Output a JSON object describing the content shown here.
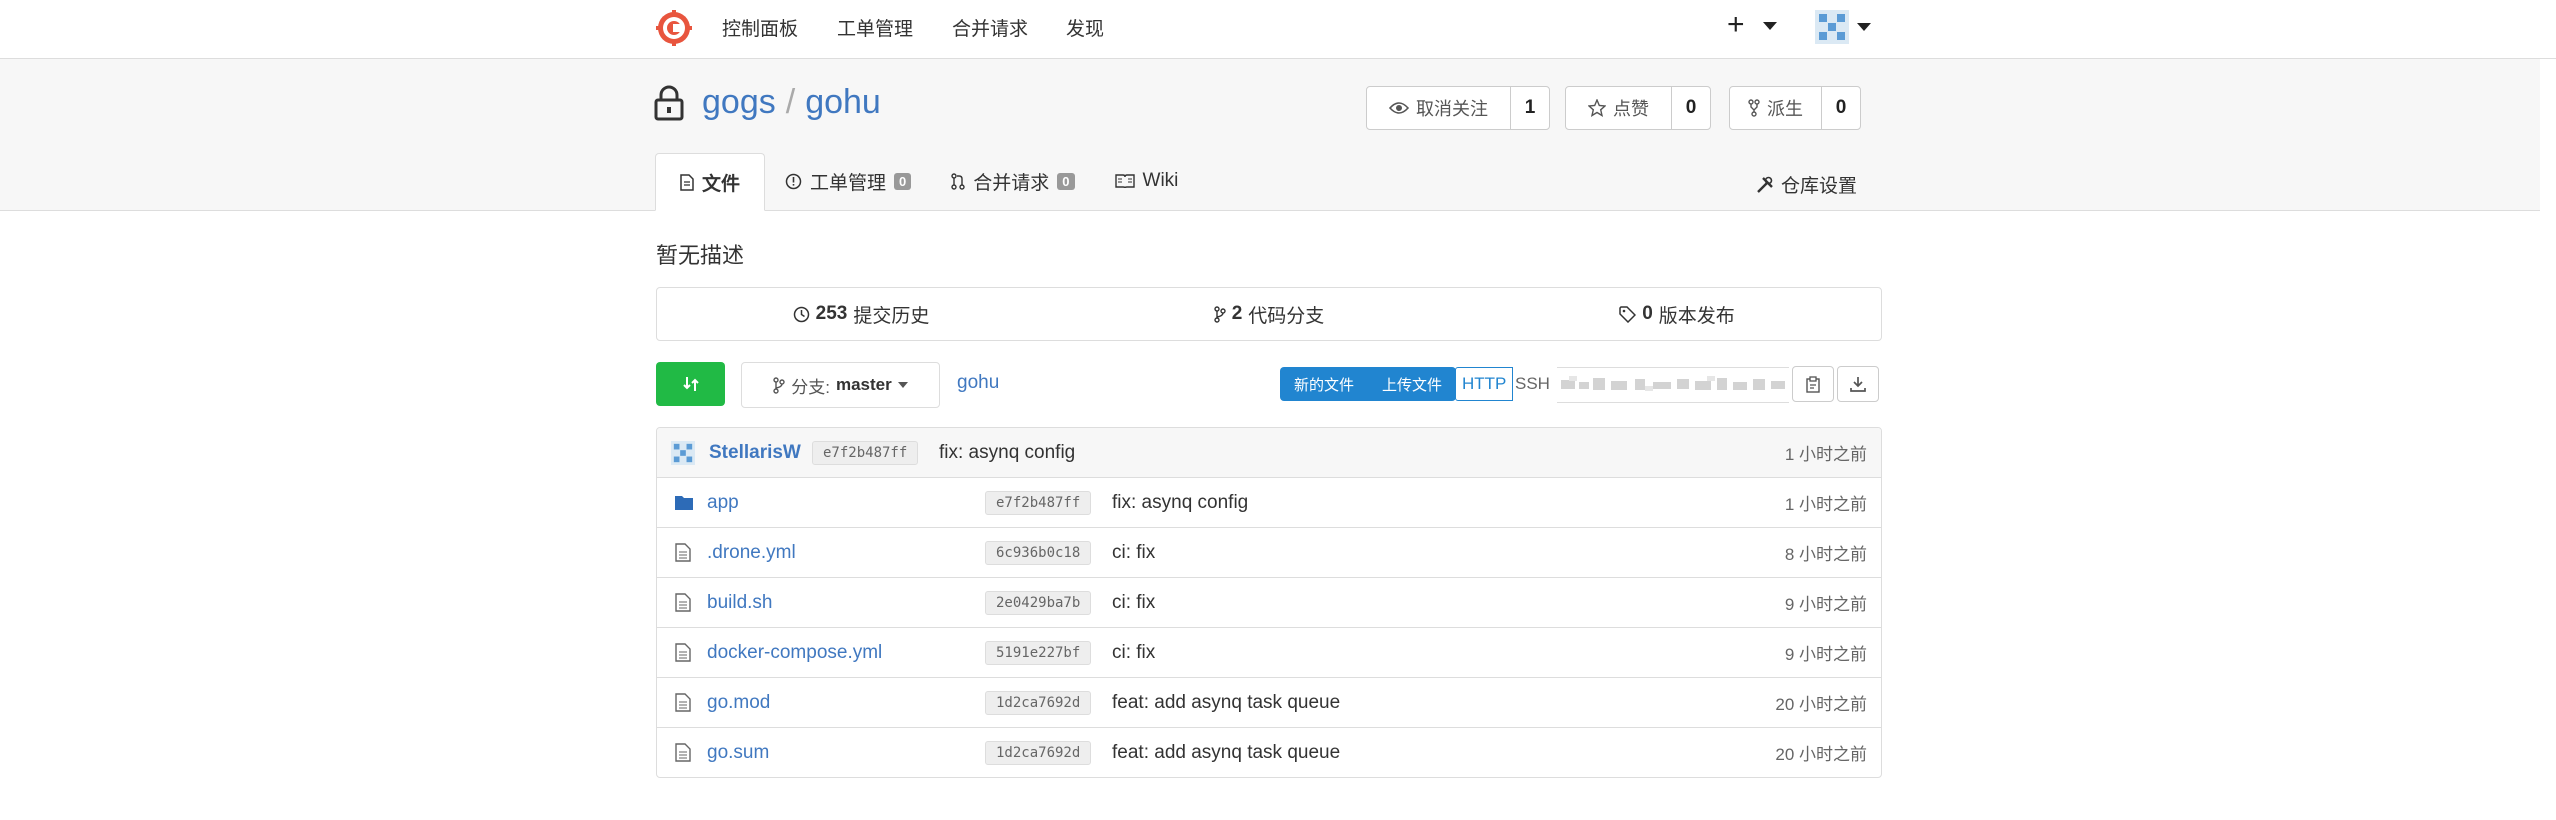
{
  "nav": {
    "items": [
      "控制面板",
      "工单管理",
      "合并请求",
      "发现"
    ],
    "plus": "+"
  },
  "repo": {
    "owner": "gogs",
    "separator": "/",
    "name": "gohu",
    "watch": {
      "label": "取消关注",
      "count": "1"
    },
    "star": {
      "label": "点赞",
      "count": "0"
    },
    "fork": {
      "label": "派生",
      "count": "0"
    }
  },
  "tabs": [
    {
      "label": "文件",
      "badge": null,
      "active": true
    },
    {
      "label": "工单管理",
      "badge": "0"
    },
    {
      "label": "合并请求",
      "badge": "0"
    },
    {
      "label": "Wiki",
      "badge": null
    }
  ],
  "settings_label": "仓库设置",
  "description": "暂无描述",
  "stats": {
    "commits": {
      "count": "253",
      "label": "提交历史"
    },
    "branches": {
      "count": "2",
      "label": "代码分支"
    },
    "releases": {
      "count": "0",
      "label": "版本发布"
    }
  },
  "toolbar": {
    "branch_prefix": "分支:",
    "branch": "master",
    "crumb": "gohu",
    "new_file": "新的文件",
    "upload_file": "上传文件",
    "http": "HTTP",
    "ssh": "SSH"
  },
  "latest_commit": {
    "author": "StellarisW",
    "sha": "e7f2b487ff",
    "message": "fix: asynq config",
    "age": "1 小时之前"
  },
  "files": [
    {
      "name": "app",
      "type": "folder",
      "sha": "e7f2b487ff",
      "message": "fix: asynq config",
      "age": "1 小时之前"
    },
    {
      "name": ".drone.yml",
      "type": "file",
      "sha": "6c936b0c18",
      "message": "ci: fix",
      "age": "8 小时之前"
    },
    {
      "name": "build.sh",
      "type": "file",
      "sha": "2e0429ba7b",
      "message": "ci: fix",
      "age": "9 小时之前"
    },
    {
      "name": "docker-compose.yml",
      "type": "file",
      "sha": "5191e227bf",
      "message": "ci: fix",
      "age": "9 小时之前"
    },
    {
      "name": "go.mod",
      "type": "file",
      "sha": "1d2ca7692d",
      "message": "feat: add asynq task queue",
      "age": "20 小时之前"
    },
    {
      "name": "go.sum",
      "type": "file",
      "sha": "1d2ca7692d",
      "message": "feat: add asynq task queue",
      "age": "20 小时之前"
    }
  ],
  "colors": {
    "link": "#4078c0",
    "green": "#21ba45",
    "blue": "#2185d0",
    "header_bg": "#f7f7f7"
  }
}
